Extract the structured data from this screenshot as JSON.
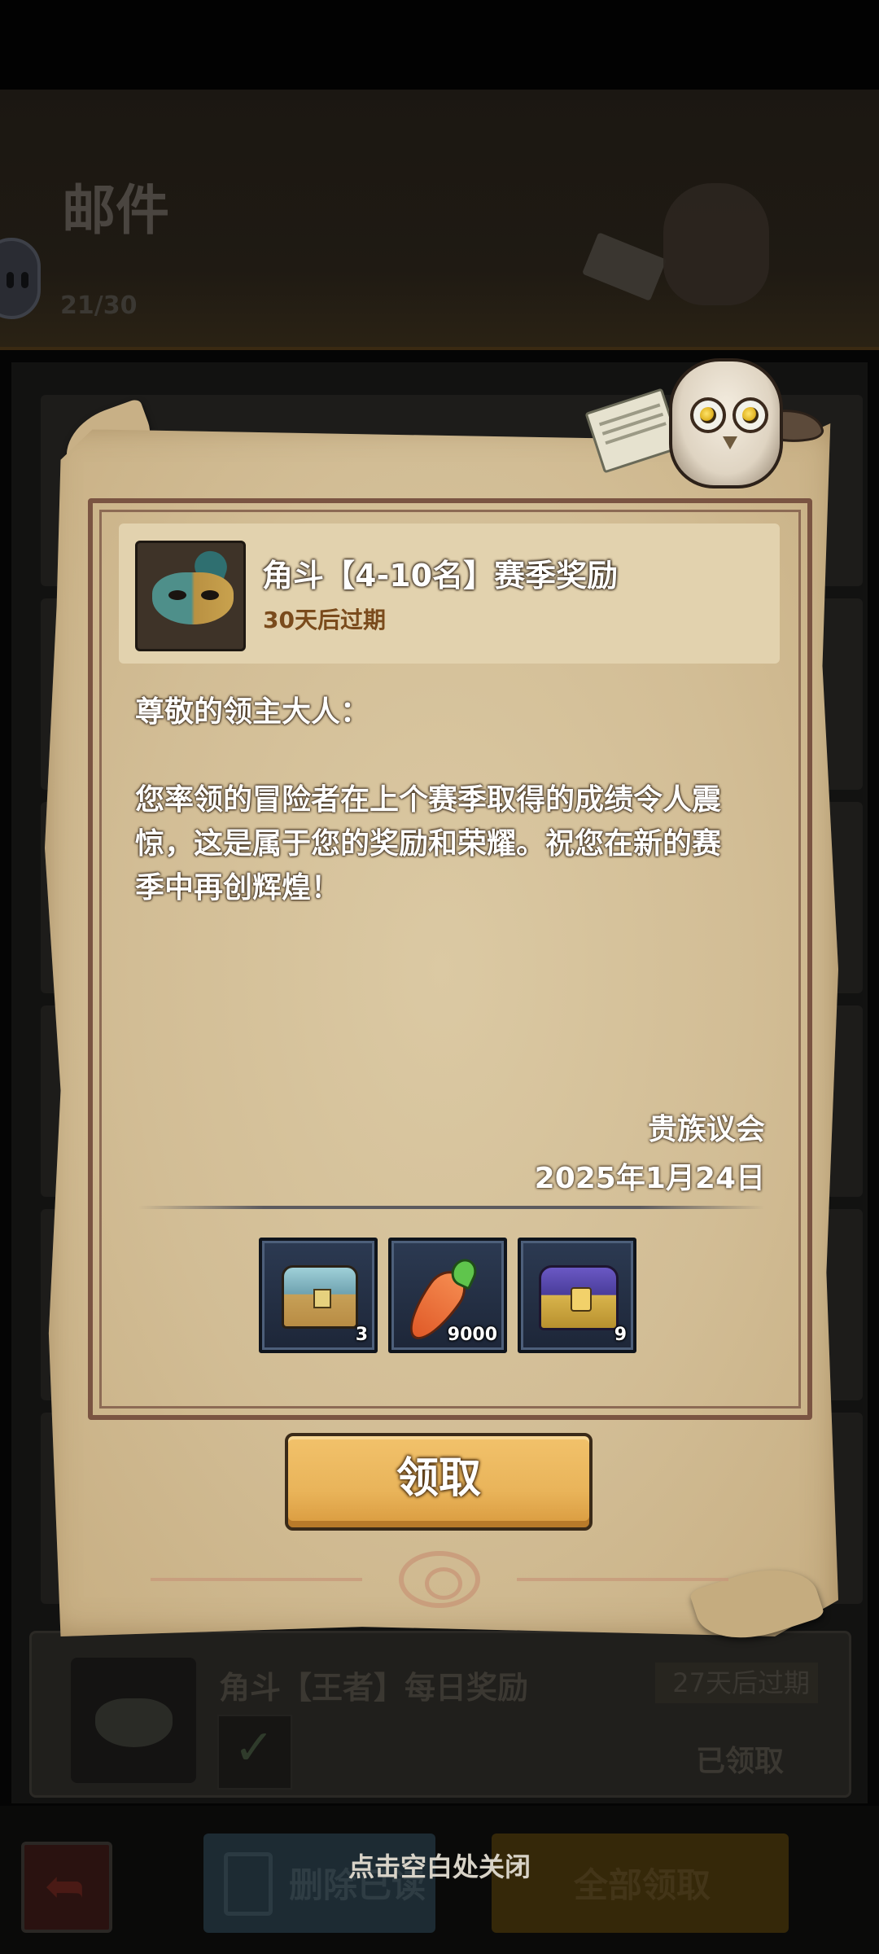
{
  "background": {
    "screen_title": "邮件",
    "mail_count": "21/30",
    "list_item": {
      "title": "角斗【王者】每日奖励",
      "expire": "27天后过期",
      "status": "已领取"
    },
    "footer": {
      "delete_label": "删除已读",
      "claim_all_label": "全部领取"
    }
  },
  "popup": {
    "header": {
      "icon": "gladiator-mask-icon",
      "title": "角斗【4-10名】赛季奖励",
      "expire": "30天后过期"
    },
    "body": {
      "greeting": "尊敬的领主大人：",
      "line1": "您率领的冒险者在上个赛季取得的成绩令人震",
      "line2": "惊，这是属于您的奖励和荣耀。祝您在新的赛",
      "line3": "季中再创辉煌！"
    },
    "sender": "贵族议会",
    "date": "2025年1月24日",
    "rewards": [
      {
        "icon": "blue-treasure-chest-icon",
        "count": "3"
      },
      {
        "icon": "carrot-icon",
        "count": "9000"
      },
      {
        "icon": "purple-treasure-chest-icon",
        "count": "9"
      }
    ],
    "claim_label": "领取"
  },
  "close_hint": "点击空白处关闭",
  "colors": {
    "parchment": "#d2bd95",
    "frame": "#7a5442",
    "button": "#e9b45a",
    "expire_text": "#7a4b1c"
  }
}
